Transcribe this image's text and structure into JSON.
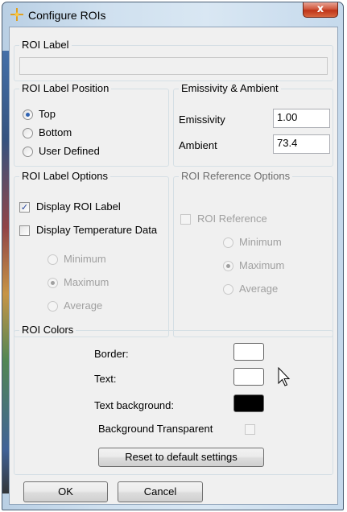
{
  "window": {
    "title": "Configure ROIs",
    "close_label": "x"
  },
  "roi_label": {
    "group_title": "ROI Label",
    "value": ""
  },
  "label_position": {
    "group_title": "ROI Label Position",
    "options": [
      {
        "label": "Top",
        "checked": true
      },
      {
        "label": "Bottom",
        "checked": false
      },
      {
        "label": "User Defined",
        "checked": false
      }
    ]
  },
  "emissivity_ambient": {
    "group_title": "Emissivity & Ambient",
    "emissivity_label": "Emissivity",
    "emissivity_value": "1.00",
    "ambient_label": "Ambient",
    "ambient_value": "73.4"
  },
  "label_options": {
    "group_title": "ROI Label Options",
    "display_roi_label": "Display ROI Label",
    "display_roi_label_checked": true,
    "display_temperature": "Display Temperature Data",
    "display_temperature_checked": false,
    "temp_options": [
      {
        "label": "Minimum",
        "checked": false
      },
      {
        "label": "Maximum",
        "checked": true
      },
      {
        "label": "Average",
        "checked": false
      }
    ]
  },
  "reference_options": {
    "group_title": "ROI Reference Options",
    "roi_reference": "ROI Reference",
    "options": [
      {
        "label": "Minimum",
        "checked": false
      },
      {
        "label": "Maximum",
        "checked": true
      },
      {
        "label": "Average",
        "checked": false
      }
    ]
  },
  "colors": {
    "group_title": "ROI Colors",
    "border_label": "Border:",
    "border_color": "#ffffff",
    "text_label": "Text:",
    "text_color": "#ffffff",
    "text_bg_label": "Text background:",
    "text_bg_color": "#000000",
    "bg_transparent_label": "Background Transparent",
    "bg_transparent_checked": false,
    "reset_label": "Reset to default settings"
  },
  "buttons": {
    "ok": "OK",
    "cancel": "Cancel"
  }
}
